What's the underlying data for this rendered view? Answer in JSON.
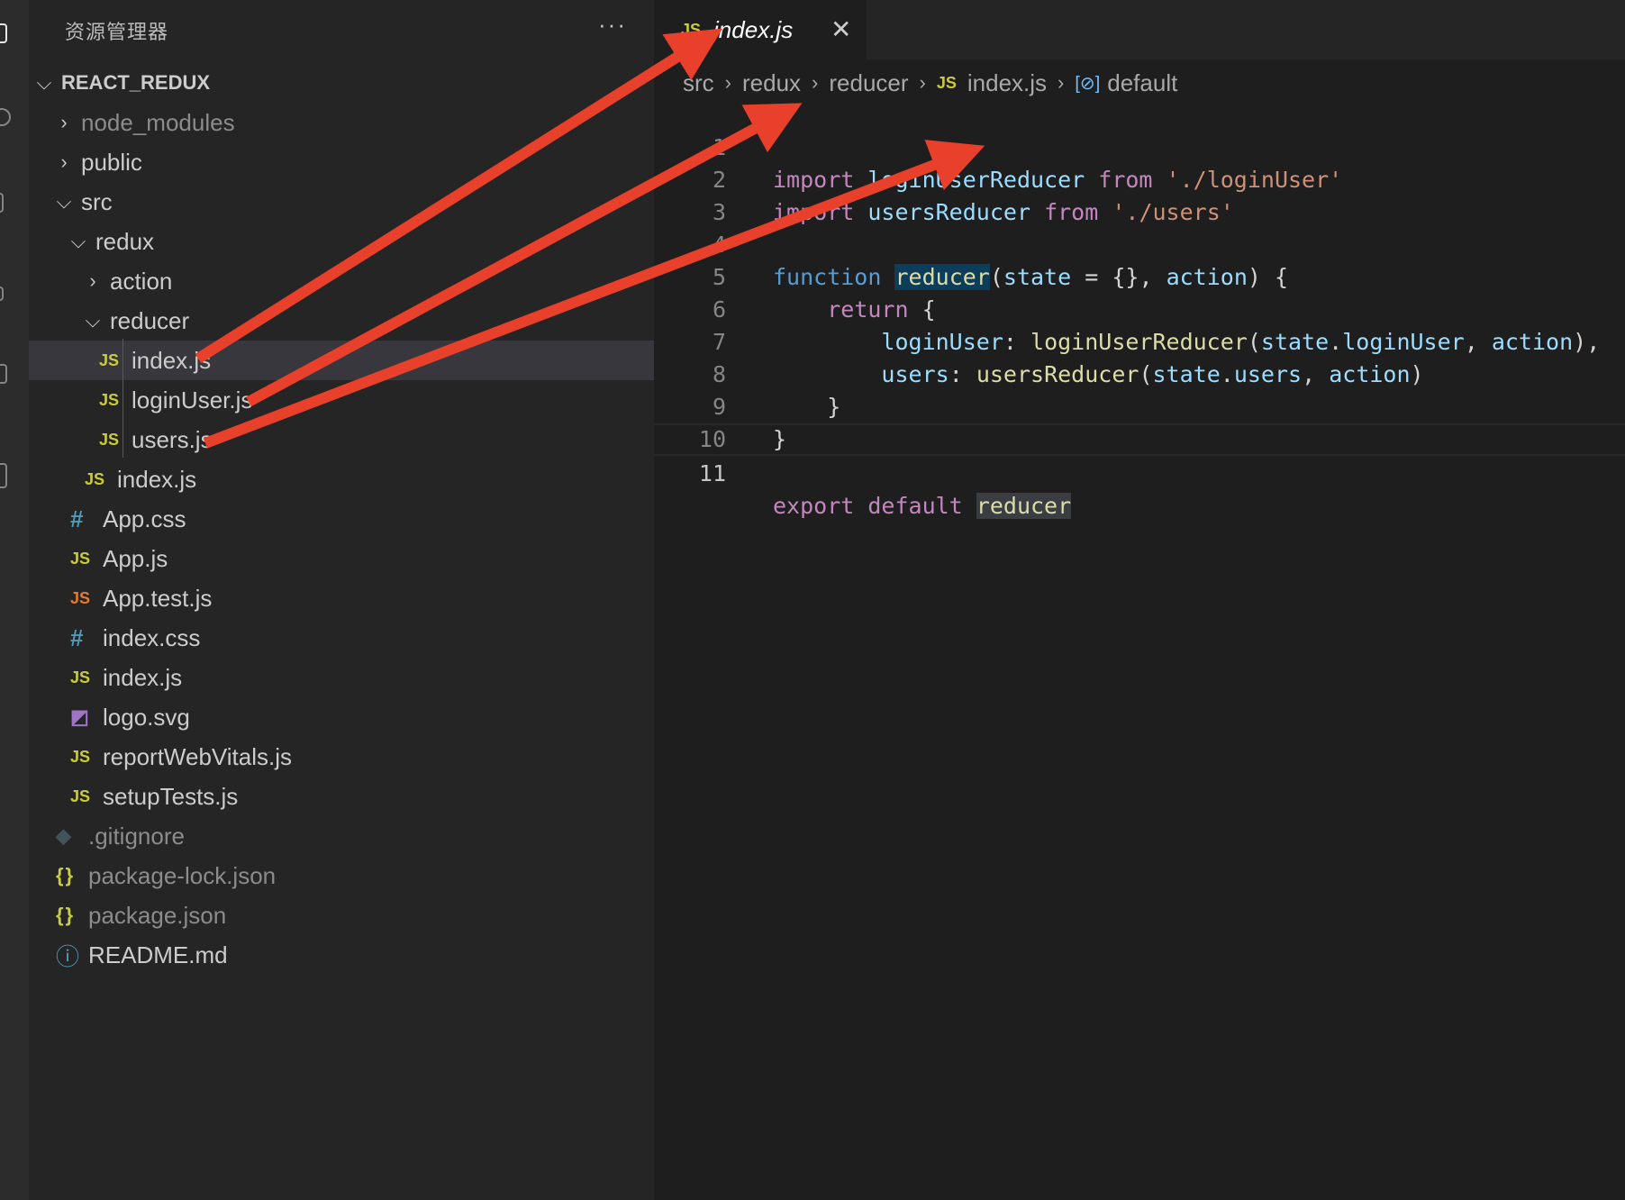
{
  "explorer": {
    "title": "资源管理器",
    "more_label": "···",
    "tree": [
      {
        "label": "REACT_REDUX",
        "icon": "chevron-down-icon",
        "type": "root"
      },
      {
        "label": "node_modules",
        "icon": "chevron-right-icon",
        "type": "folder",
        "dim": true
      },
      {
        "label": "public",
        "icon": "chevron-right-icon",
        "type": "folder"
      },
      {
        "label": "src",
        "icon": "chevron-down-icon",
        "type": "folder"
      },
      {
        "label": "redux",
        "icon": "chevron-down-icon",
        "type": "folder"
      },
      {
        "label": "action",
        "icon": "chevron-right-icon",
        "type": "folder"
      },
      {
        "label": "reducer",
        "icon": "chevron-down-icon",
        "type": "folder"
      },
      {
        "label": "index.js",
        "icon": "js-file-icon",
        "type": "file",
        "badge": "JS",
        "selected": true
      },
      {
        "label": "loginUser.js",
        "icon": "js-file-icon",
        "type": "file",
        "badge": "JS"
      },
      {
        "label": "users.js",
        "icon": "js-file-icon",
        "type": "file",
        "badge": "JS"
      },
      {
        "label": "index.js",
        "icon": "js-file-icon",
        "type": "file",
        "badge": "JS"
      },
      {
        "label": "App.css",
        "icon": "css-file-icon",
        "type": "file",
        "badge": "#"
      },
      {
        "label": "App.js",
        "icon": "js-file-icon",
        "type": "file",
        "badge": "JS"
      },
      {
        "label": "App.test.js",
        "icon": "test-file-icon",
        "type": "file",
        "badge": "JS"
      },
      {
        "label": "index.css",
        "icon": "css-file-icon",
        "type": "file",
        "badge": "#"
      },
      {
        "label": "index.js",
        "icon": "js-file-icon",
        "type": "file",
        "badge": "JS"
      },
      {
        "label": "logo.svg",
        "icon": "svg-file-icon",
        "type": "file",
        "badge": "◩"
      },
      {
        "label": "reportWebVitals.js",
        "icon": "js-file-icon",
        "type": "file",
        "badge": "JS"
      },
      {
        "label": "setupTests.js",
        "icon": "js-file-icon",
        "type": "file",
        "badge": "JS"
      },
      {
        "label": ".gitignore",
        "icon": "git-file-icon",
        "type": "file",
        "badge": "◆",
        "dim": true
      },
      {
        "label": "package-lock.json",
        "icon": "json-file-icon",
        "type": "file",
        "badge": "{}",
        "dim": true
      },
      {
        "label": "package.json",
        "icon": "json-file-icon",
        "type": "file",
        "badge": "{}",
        "dim": true
      },
      {
        "label": "README.md",
        "icon": "info-file-icon",
        "type": "file",
        "badge": "ⓘ"
      }
    ]
  },
  "editor": {
    "tab": {
      "badge": "JS",
      "label": "index.js",
      "close": "✕"
    },
    "breadcrumb": {
      "parts": [
        "src",
        "redux",
        "reducer",
        "index.js",
        "default"
      ],
      "file_badge": "JS",
      "symbol_badge": "[⊘]"
    },
    "line_numbers": [
      "1",
      "2",
      "3",
      "4",
      "5",
      "6",
      "7",
      "8",
      "9",
      "10",
      "11"
    ],
    "current_line": "11"
  },
  "colors": {
    "keyword": "#c586c0",
    "function": "#dcdcaa",
    "variable": "#9cdcfe",
    "string": "#ce9178",
    "annotation_arrow": "#e8402a"
  }
}
